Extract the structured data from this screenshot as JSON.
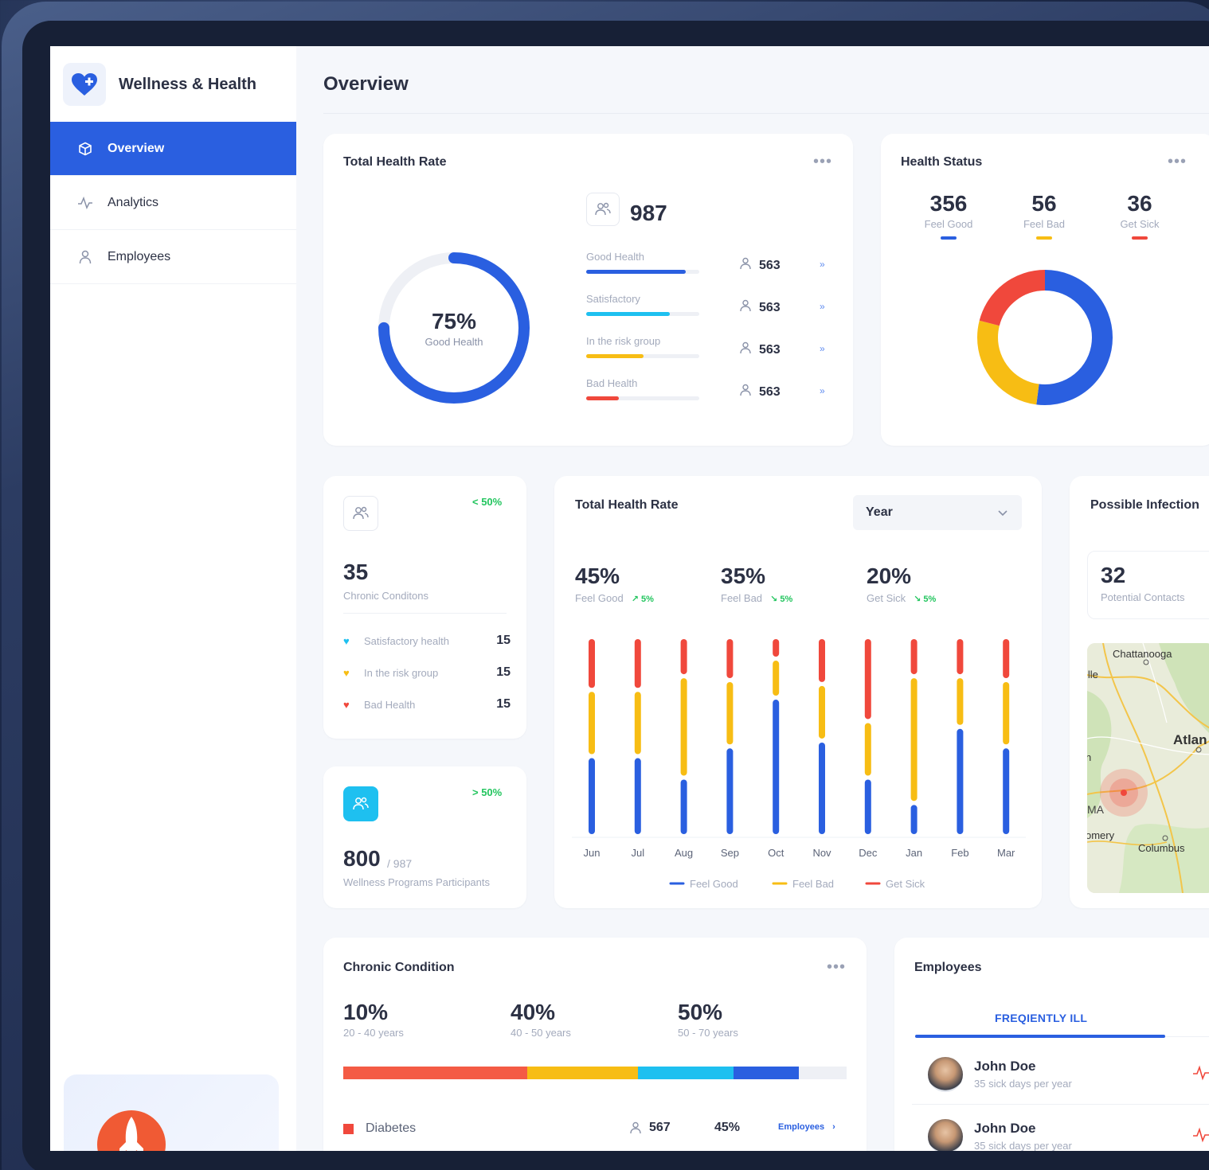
{
  "brand": {
    "name": "Wellness & Health",
    "logo_icon": "heart-plus-icon",
    "accent": "#2a5fe0"
  },
  "sidebar": {
    "items": [
      {
        "label": "Overview",
        "icon": "cube-icon",
        "active": true
      },
      {
        "label": "Analytics",
        "icon": "activity-icon",
        "active": false
      },
      {
        "label": "Employees",
        "icon": "user-icon",
        "active": false
      }
    ]
  },
  "page": {
    "title": "Overview"
  },
  "total_health_rate": {
    "title": "Total Health Rate",
    "donut_value": "75%",
    "donut_label": "Good Health",
    "donut_fraction": 0.75,
    "total": "987",
    "metrics": [
      {
        "label": "Good Health",
        "count": "563",
        "fill": 0.88,
        "color": "#2a5fe0"
      },
      {
        "label": "Satisfactory",
        "count": "563",
        "fill": 0.74,
        "color": "#1ec0f0"
      },
      {
        "label": "In the risk group",
        "count": "563",
        "fill": 0.51,
        "color": "#f7bd14"
      },
      {
        "label": "Bad Health",
        "count": "563",
        "fill": 0.29,
        "color": "#f0483c"
      }
    ],
    "row_arrow": "»"
  },
  "health_status": {
    "title": "Health Status",
    "stats": [
      {
        "value": "356",
        "label": "Feel Good",
        "color": "#2a5fe0"
      },
      {
        "value": "56",
        "label": "Feel Bad",
        "color": "#f7bd14"
      },
      {
        "value": "36",
        "label": "Get Sick",
        "color": "#f0483c"
      }
    ],
    "donut": [
      {
        "label": "Feel Good",
        "fraction": 0.52,
        "color": "#2a5fe0"
      },
      {
        "label": "Feel Bad",
        "fraction": 0.27,
        "color": "#f7bd14"
      },
      {
        "label": "Get Sick",
        "fraction": 0.21,
        "color": "#f0483c"
      }
    ]
  },
  "chronic_card": {
    "badge": "< 50%",
    "value": "35",
    "label": "Chronic Conditons",
    "legend": [
      {
        "label": "Satisfactory health",
        "value": "15",
        "color": "#1ec0f0"
      },
      {
        "label": "In the risk group",
        "value": "15",
        "color": "#f7bd14"
      },
      {
        "label": "Bad Health",
        "value": "15",
        "color": "#f0483c"
      }
    ]
  },
  "wellness_card": {
    "badge": "> 50%",
    "value": "800",
    "total": "/ 987",
    "label": "Wellness Programs Participants"
  },
  "bar_chart_card": {
    "title": "Total Health Rate",
    "select_value": "Year",
    "kpis": [
      {
        "value": "45%",
        "label": "Feel Good",
        "trend": "↗ 5%"
      },
      {
        "value": "35%",
        "label": "Feel Bad",
        "trend": "↘ 5%"
      },
      {
        "value": "20%",
        "label": "Get Sick",
        "trend": "↘ 5%"
      }
    ]
  },
  "chart_data": {
    "type": "bar",
    "stacked": true,
    "categories": [
      "Jun",
      "Jul",
      "Aug",
      "Sep",
      "Oct",
      "Nov",
      "Dec",
      "Jan",
      "Feb",
      "Mar"
    ],
    "series": [
      {
        "name": "Feel Good",
        "color": "#2a5fe0",
        "values": [
          41,
          41,
          30,
          46,
          71,
          49,
          30,
          17,
          56,
          46
        ]
      },
      {
        "name": "Feel Bad",
        "color": "#f7bd14",
        "values": [
          34,
          34,
          52,
          34,
          20,
          29,
          29,
          65,
          26,
          34
        ]
      },
      {
        "name": "Get Sick",
        "color": "#f0483c",
        "values": [
          25,
          25,
          18,
          20,
          9,
          22,
          41,
          18,
          18,
          20
        ]
      }
    ],
    "legend_position": "bottom",
    "grid": false
  },
  "infection_card": {
    "title": "Possible Infection",
    "value": "32",
    "label": "Potential Contacts",
    "map_labels": [
      "Chattanooga",
      "Atlan",
      "Columbus",
      "omery",
      "MA",
      "ille",
      "n"
    ]
  },
  "chronic_condition": {
    "title": "Chronic Condition",
    "stats": [
      {
        "value": "10%",
        "label": "20 - 40 years"
      },
      {
        "value": "40%",
        "label": "40 - 50 years"
      },
      {
        "value": "50%",
        "label": "50 - 70 years"
      }
    ],
    "stack": [
      {
        "fraction": 0.365,
        "color": "#f45b45"
      },
      {
        "fraction": 0.22,
        "color": "#f7bd14"
      },
      {
        "fraction": 0.19,
        "color": "#1ec0f0"
      },
      {
        "fraction": 0.13,
        "color": "#2a5fe0"
      }
    ],
    "rows": [
      {
        "label": "Diabetes",
        "count": "567",
        "pct": "45%",
        "link": "Employees",
        "color": "#f0483c"
      }
    ]
  },
  "employees_card": {
    "title": "Employees",
    "tab": "FREQIENTLY ILL",
    "list": [
      {
        "name": "John Doe",
        "sub": "35 sick days per year"
      },
      {
        "name": "John Doe",
        "sub": "35 sick days per year"
      }
    ]
  }
}
